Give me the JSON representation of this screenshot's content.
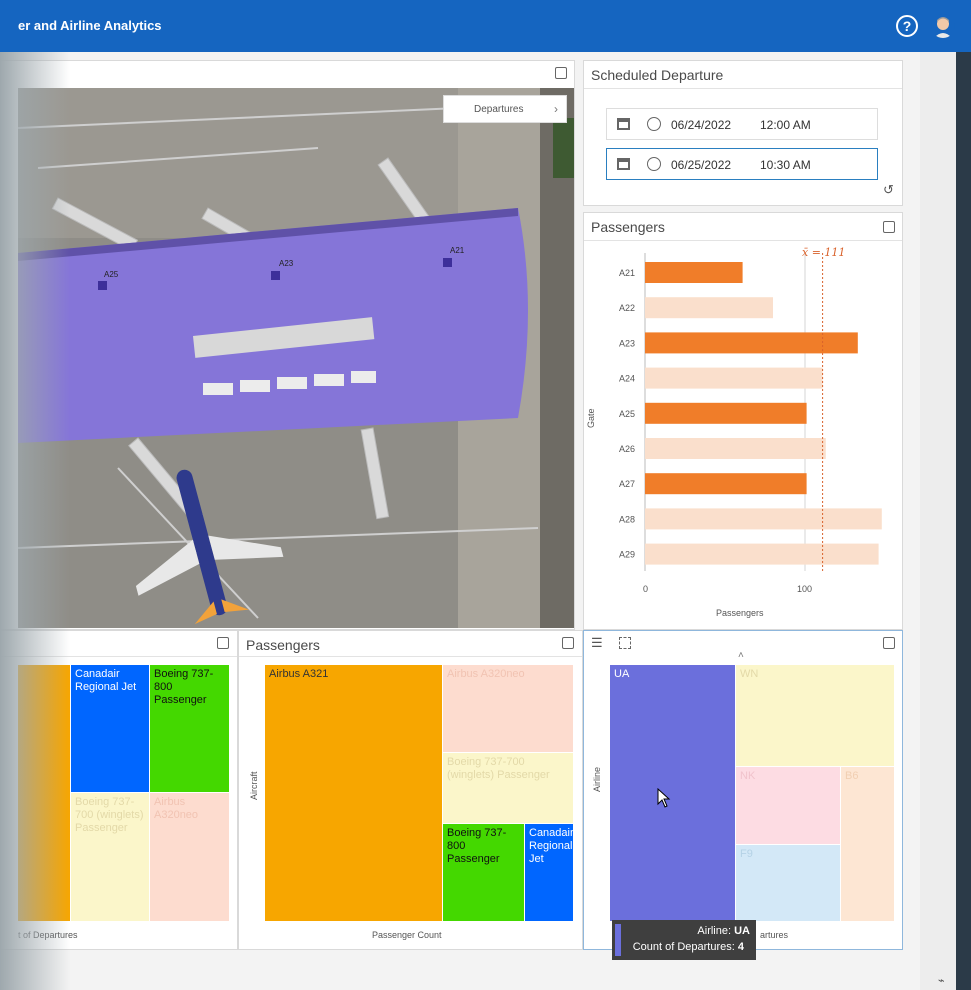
{
  "header": {
    "title": "er and Airline Analytics",
    "help": "?"
  },
  "map": {
    "departures_button": "Departures",
    "gates": [
      "A25",
      "A23",
      "A21"
    ]
  },
  "schedule": {
    "title": "Scheduled Departure",
    "start": {
      "date": "06/24/2022",
      "time": "12:00 AM"
    },
    "end": {
      "date": "06/25/2022",
      "time": "10:30 AM"
    }
  },
  "passengers_bar": {
    "title": "Passengers",
    "mean_label": "x̄ = 111",
    "y_axis_label": "Gate",
    "x_axis_label": "Passengers",
    "x_ticks": [
      "0",
      "100"
    ]
  },
  "chart_data": [
    {
      "type": "bar",
      "orientation": "horizontal",
      "title": "Passengers",
      "categories": [
        "A21",
        "A22",
        "A23",
        "A24",
        "A25",
        "A26",
        "A27",
        "A28",
        "A29"
      ],
      "values": [
        61,
        80,
        133,
        111,
        101,
        113,
        101,
        148,
        146
      ],
      "highlighted": [
        true,
        false,
        true,
        false,
        true,
        false,
        true,
        false,
        false
      ],
      "xlabel": "Passengers",
      "ylabel": "Gate",
      "xlim": [
        0,
        150
      ],
      "mean": 111,
      "colors": {
        "selected": "#f07d29",
        "unselected": "#fadfcc"
      }
    }
  ],
  "treemap_left": {
    "x_axis_label": "t of Departures",
    "cells": [
      "Canadair Regional Jet",
      "Boeing 737-800 Passenger",
      "Boeing 737-700 (winglets) Passenger",
      "Airbus A320neo"
    ]
  },
  "treemap_middle": {
    "title": "Passengers",
    "y_axis_label": "Aircraft",
    "x_axis_label": "Passenger Count",
    "cells": [
      "Airbus A321",
      "Airbus A320neo",
      "Boeing 737-700 (winglets) Passenger",
      "Boeing 737-800 Passenger",
      "Canadair Regional Jet"
    ]
  },
  "treemap_right": {
    "y_axis_label": "Airline",
    "x_axis_label": "artures",
    "cells": [
      "UA",
      "WN",
      "NK",
      "B6",
      "F9"
    ]
  },
  "tooltip": {
    "line1_prefix": "Airline: ",
    "line1_value": "UA",
    "line2_prefix": "Count of Departures: ",
    "line2_value": "4"
  },
  "colors": {
    "header": "#1565c0",
    "orange": "#f7a600",
    "blue": "#0066ff",
    "green": "#44d800",
    "purple": "#6b6fdc",
    "accent_bar": "#f07d29"
  }
}
